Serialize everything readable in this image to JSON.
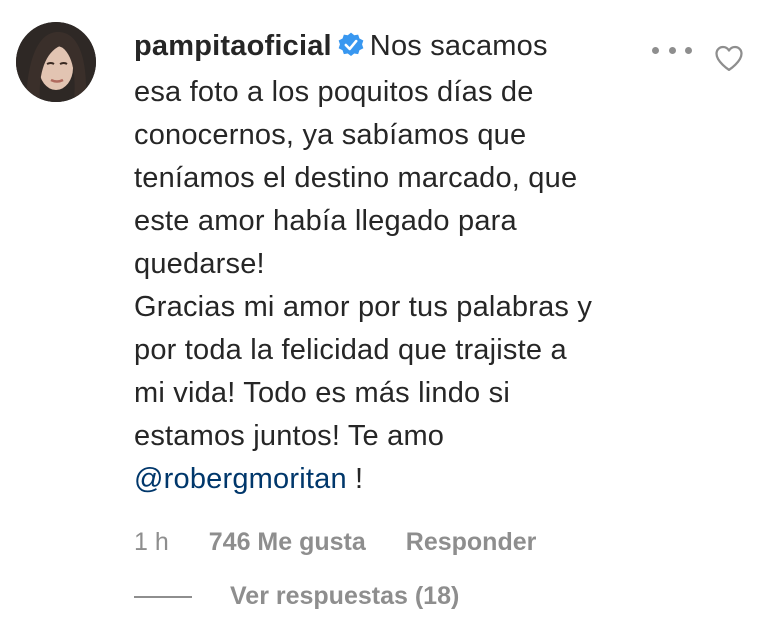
{
  "comment": {
    "username": "pampitaoficial",
    "text_lines": [
      "Nos sacamos",
      "esa foto a los poquitos días de",
      "conocernos, ya sabíamos que",
      "teníamos el destino marcado, que",
      "este amor había llegado para",
      "quedarse!",
      "Gracias mi amor por tus palabras y",
      "por toda la felicidad que trajiste a",
      "mi vida! Todo es más lindo si",
      "estamos juntos! Te amo"
    ],
    "mention": "@robergmoritan",
    "mention_suffix": " !"
  },
  "meta": {
    "time": "1 h",
    "likes": "746 Me gusta",
    "reply": "Responder"
  },
  "replies": {
    "label": "Ver respuestas (18)"
  },
  "icons": {
    "verified": "verified-badge-icon",
    "more": "more-options-icon",
    "like": "heart-outline-icon"
  },
  "colors": {
    "text": "#262626",
    "secondary": "#8e8e8e",
    "verified": "#3897f0",
    "mention": "#00376b"
  }
}
